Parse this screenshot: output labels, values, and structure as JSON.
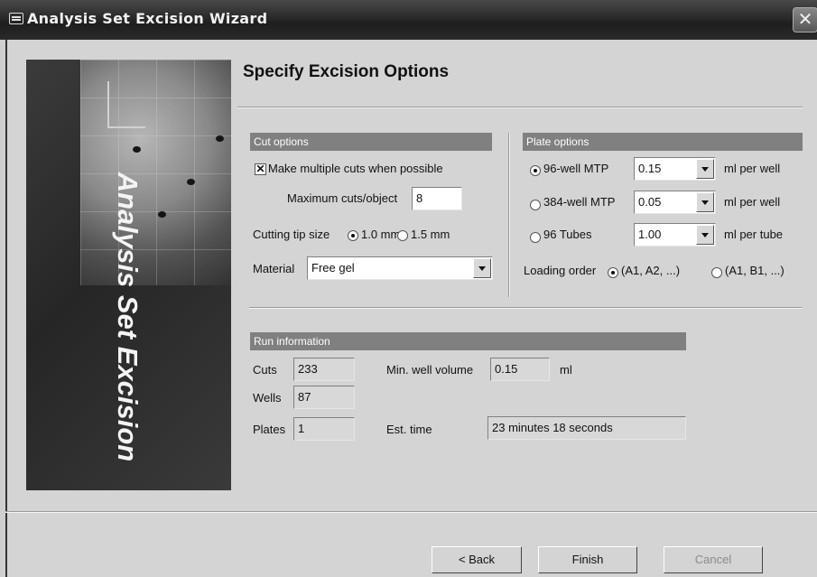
{
  "window": {
    "title": "Analysis Set Excision Wizard",
    "close_glyph": "✕"
  },
  "banner": {
    "text": "Analysis Set Excision"
  },
  "page": {
    "heading": "Specify Excision Options"
  },
  "cut_options": {
    "header": "Cut options",
    "multiple_cuts_label": "Make multiple cuts when possible",
    "multiple_cuts_checked": true,
    "max_cuts_label": "Maximum cuts/object",
    "max_cuts_value": "8",
    "tip_size_label": "Cutting tip size",
    "tip_options": [
      "1.0 mm",
      "1.5 mm"
    ],
    "tip_selected": "1.0 mm",
    "material_label": "Material",
    "material_value": "Free gel"
  },
  "plate_options": {
    "header": "Plate options",
    "rows": [
      {
        "label": "96-well MTP",
        "value": "0.15",
        "unit": "ml per well",
        "selected": true
      },
      {
        "label": "384-well MTP",
        "value": "0.05",
        "unit": "ml per well",
        "selected": false
      },
      {
        "label": "96 Tubes",
        "value": "1.00",
        "unit": "ml per tube",
        "selected": false
      }
    ],
    "loading_order_label": "Loading order",
    "loading_options": [
      "(A1, A2, ...)",
      "(A1, B1, ...)"
    ],
    "loading_selected": "(A1, A2, ...)"
  },
  "run_info": {
    "header": "Run information",
    "cuts_label": "Cuts",
    "cuts_value": "233",
    "wells_label": "Wells",
    "wells_value": "87",
    "plates_label": "Plates",
    "plates_value": "1",
    "min_well_label": "Min. well volume",
    "min_well_value": "0.15",
    "min_well_unit": "ml",
    "est_time_label": "Est. time",
    "est_time_value": "23 minutes 18 seconds"
  },
  "buttons": {
    "back": "< Back",
    "finish": "Finish",
    "cancel": "Cancel"
  },
  "colors": {
    "group_header": "#808080",
    "title_bar": "#2a2a2a",
    "banner": "#2e2e2e"
  }
}
